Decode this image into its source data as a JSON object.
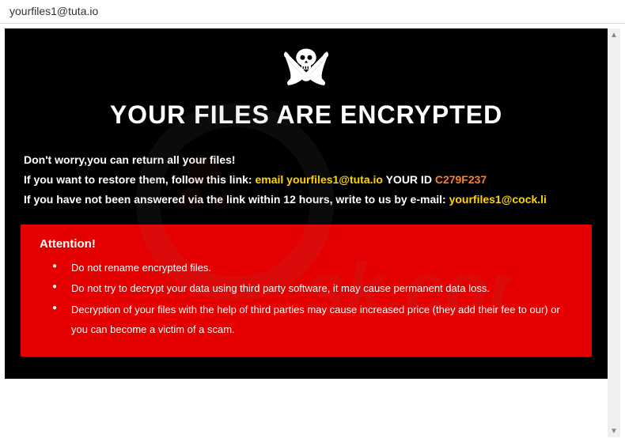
{
  "window": {
    "title": "yourfiles1@tuta.io"
  },
  "content": {
    "heading": "YOUR FILES ARE ENCRYPTED",
    "line1": "Don't worry,you can return all your files!",
    "line2_pre": "If you want to restore them, follow this link: ",
    "line2_email_label": "email yourfiles1@tuta.io",
    "line2_id_label": "  YOUR ID ",
    "line2_id": "C279F237",
    "line3_pre": "If you have not been answered via the link within 12 hours, write to us by e-mail: ",
    "line3_email": "yourfiles1@cock.li"
  },
  "attention": {
    "heading": "Attention!",
    "items": [
      "Do not rename encrypted files.",
      "Do not try to decrypt your data using third party software, it may cause permanent data loss.",
      "Decryption of your files with the help of third parties may cause increased price (they add their fee to our) or you can become a victim of a scam."
    ]
  },
  "icons": {
    "skull": "skull-swords-icon",
    "scroll_up": "▲",
    "scroll_down": "▼"
  }
}
